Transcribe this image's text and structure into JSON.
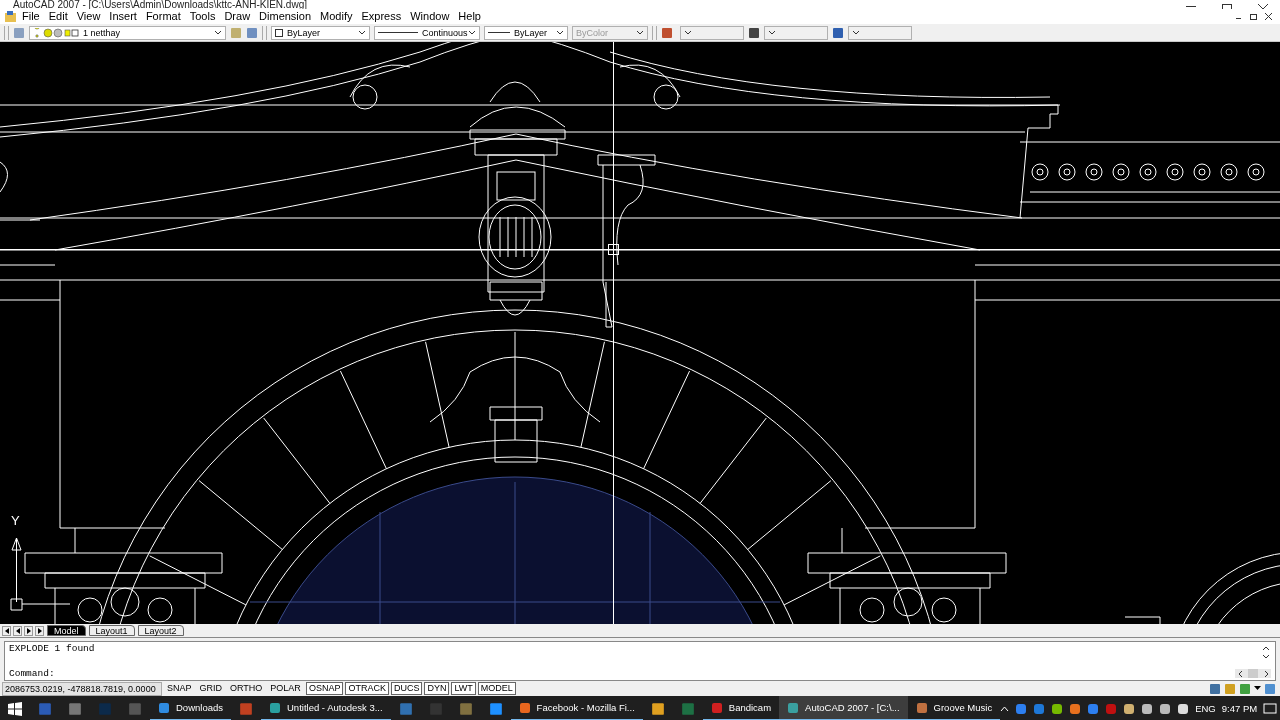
{
  "window": {
    "title": "AutoCAD 2007 - [C:\\Users\\Admin\\Downloads\\kttc-ANH-KIEN.dwg]"
  },
  "menu": [
    "File",
    "Edit",
    "View",
    "Insert",
    "Format",
    "Tools",
    "Draw",
    "Dimension",
    "Modify",
    "Express",
    "Window",
    "Help"
  ],
  "toolbar": {
    "combos": [
      {
        "kind": "layer",
        "value": "1 netthay",
        "disabled": false
      },
      {
        "kind": "color",
        "value": "ByLayer",
        "disabled": false
      },
      {
        "kind": "linetype",
        "value": "Continuous",
        "disabled": false
      },
      {
        "kind": "lineweight",
        "value": "ByLayer",
        "disabled": false
      },
      {
        "kind": "plot_style",
        "value": "ByColor",
        "disabled": true
      }
    ]
  },
  "ucs": {
    "axis": "Y"
  },
  "layout_tabs": [
    {
      "label": "Model",
      "selected": true
    },
    {
      "label": "Layout1",
      "selected": false
    },
    {
      "label": "Layout2",
      "selected": false
    }
  ],
  "command_lines": [
    "EXPLODE 1 found",
    "Command:"
  ],
  "status_bar": {
    "coordinates": "2086753.0219, -478818.7819, 0.0000",
    "toggles": [
      {
        "label": "SNAP",
        "on": false
      },
      {
        "label": "GRID",
        "on": false
      },
      {
        "label": "ORTHO",
        "on": false
      },
      {
        "label": "POLAR",
        "on": false
      },
      {
        "label": "OSNAP",
        "on": true
      },
      {
        "label": "OTRACK",
        "on": true
      },
      {
        "label": "DUCS",
        "on": true
      },
      {
        "label": "DYN",
        "on": true
      },
      {
        "label": "LWT",
        "on": true
      },
      {
        "label": "MODEL",
        "on": true
      }
    ]
  },
  "taskbar": {
    "apps": [
      {
        "label": "Downloads",
        "selected": false
      },
      {
        "label": "Untitled - Autodesk 3...",
        "selected": false
      },
      {
        "label": "Facebook - Mozilla Fi...",
        "selected": false
      },
      {
        "label": "Bandicam",
        "selected": false
      },
      {
        "label": "AutoCAD 2007 - [C:\\...",
        "selected": true
      },
      {
        "label": "Groove Music",
        "selected": false
      }
    ],
    "language": "ENG",
    "time": "9:47 PM"
  }
}
